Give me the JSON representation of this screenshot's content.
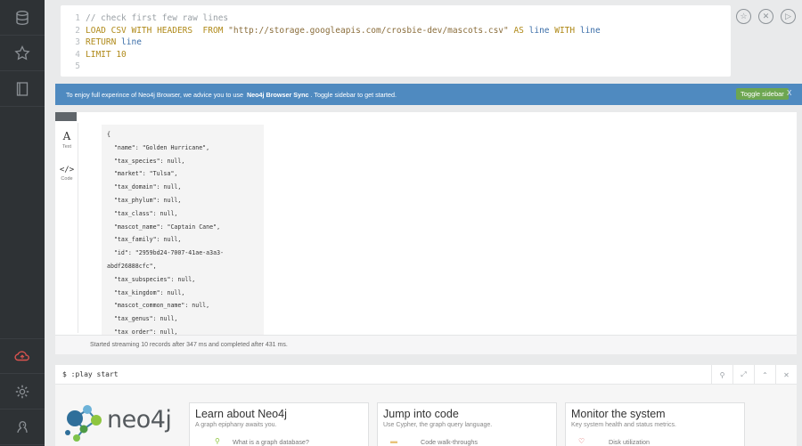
{
  "sidebar": {
    "items": [
      {
        "icon": "database-icon"
      },
      {
        "icon": "star-icon"
      },
      {
        "icon": "document-icon"
      },
      {
        "icon": "cloud-sync-icon"
      },
      {
        "icon": "gear-icon"
      },
      {
        "icon": "about-icon"
      }
    ]
  },
  "editor": {
    "lines": [
      {
        "no": "1",
        "text": "// check first few raw lines"
      },
      {
        "no": "2",
        "text": "LOAD CSV WITH HEADERS  FROM \"http://storage.googleapis.com/crosbie-dev/mascots.csv\" AS line WITH line"
      },
      {
        "no": "3",
        "text": "RETURN line"
      },
      {
        "no": "4",
        "text": "LIMIT 10"
      },
      {
        "no": "5",
        "text": ""
      }
    ],
    "actions": [
      "favorite-icon",
      "clear-icon",
      "run-icon"
    ]
  },
  "banner": {
    "text_before": "To enjoy full experince of Neo4j Browser, we advice you to use",
    "bold": "Neo4j Browser Sync",
    "text_after": ". Toggle sidebar to get started.",
    "button": "Toggle sidebar",
    "close": "X"
  },
  "result": {
    "tabs": [
      {
        "label": "Text",
        "glyph": "A"
      },
      {
        "label": "Code",
        "glyph": "</>"
      }
    ],
    "json_lines": [
      "{",
      "  \"name\": \"Golden Hurricane\",",
      "  \"tax_species\": null,",
      "  \"market\": \"Tulsa\",",
      "  \"tax_domain\": null,",
      "  \"tax_phylum\": null,",
      "  \"tax_class\": null,",
      "  \"mascot_name\": \"Captain Cane\",",
      "  \"tax_family\": null,",
      "  \"id\": \"2959bd24-7007-41ae-a3a3-",
      "abdf26888cfc\",",
      "  \"tax_subspecies\": null,",
      "  \"tax_kingdom\": null,",
      "  \"mascot_common_name\": null,",
      "  \"tax_genus\": null,",
      "  \"tax_order\": null,"
    ],
    "status": "Started streaming 10 records after 347 ms and completed after 431 ms."
  },
  "play": {
    "command": "$ :play start",
    "logo_text": "neo4j",
    "cards": [
      {
        "title": "Learn about Neo4j",
        "subtitle": "A graph epiphany awaits you.",
        "item": "What is a graph database?"
      },
      {
        "title": "Jump into code",
        "subtitle": "Use Cypher, the graph query language.",
        "item": "Code walk-throughs"
      },
      {
        "title": "Monitor the system",
        "subtitle": "Key system health and status metrics.",
        "item": "Disk utilization"
      }
    ]
  },
  "colors": {
    "sidebar": "#2e3235",
    "banner": "#4f8ac0",
    "toggle_button": "#6da651",
    "active_sidebar_icon": "#d9534f"
  }
}
